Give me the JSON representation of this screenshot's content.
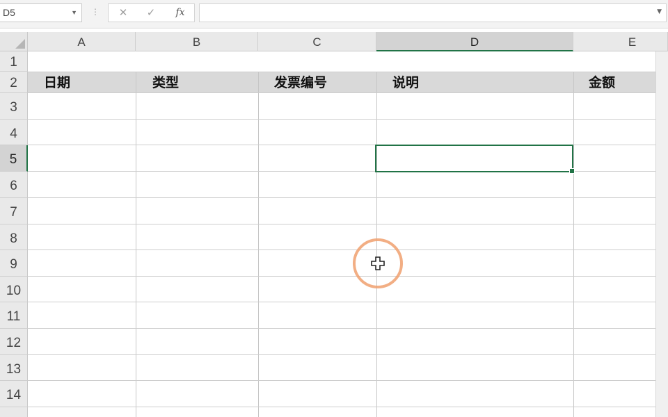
{
  "formula_bar": {
    "name_box": "D5",
    "cancel_symbol": "✕",
    "enter_symbol": "✓",
    "function_label": "fx",
    "formula_value": ""
  },
  "sheet": {
    "columns": [
      "A",
      "B",
      "C",
      "D",
      "E"
    ],
    "rows": [
      "1",
      "2",
      "3",
      "4",
      "5",
      "6",
      "7",
      "8",
      "9",
      "10",
      "11",
      "12",
      "13",
      "14"
    ],
    "selected_cell": "D5",
    "header_row": {
      "A": "日期",
      "B": "类型",
      "C": "发票编号",
      "D": "说明",
      "E": "金额"
    }
  },
  "colors": {
    "selection": "#217346",
    "header_fill": "#d9d9d9",
    "click_ring": "#f0a06e"
  }
}
